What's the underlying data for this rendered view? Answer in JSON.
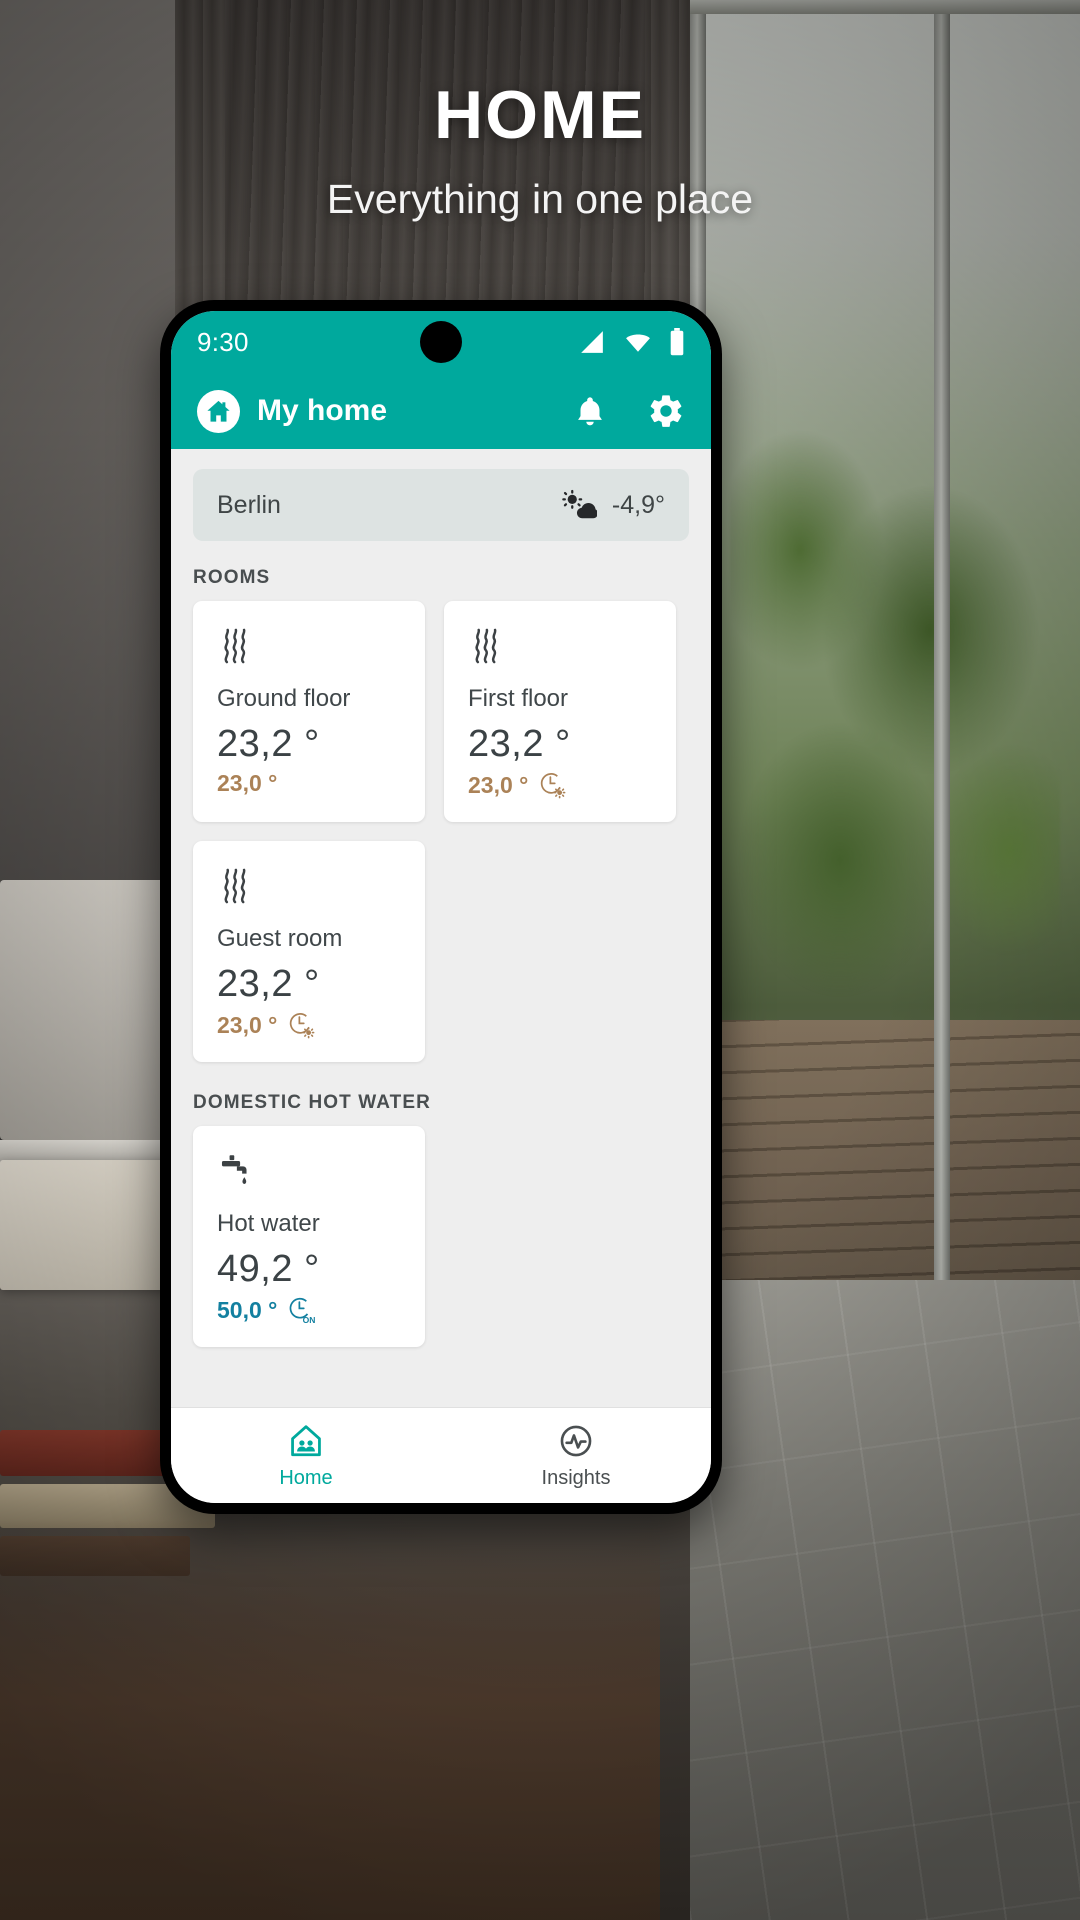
{
  "promo": {
    "title": "HOME",
    "subtitle": "Everything in one place"
  },
  "colors": {
    "brand_teal": "#00a99d",
    "target_warm": "#ab8257",
    "target_cool": "#1380a0",
    "screen_bg": "#eeeeee",
    "card_bg": "#ffffff",
    "weather_bg": "#dde3e2"
  },
  "status_bar": {
    "time": "9:30",
    "icons": [
      "signal-icon",
      "wifi-icon",
      "battery-icon"
    ]
  },
  "app_bar": {
    "home_icon": "home-icon",
    "title": "My home",
    "actions": [
      {
        "name": "notifications-button",
        "icon": "bell-icon"
      },
      {
        "name": "settings-button",
        "icon": "gear-icon"
      }
    ]
  },
  "weather": {
    "city": "Berlin",
    "icon": "sun-cloud-icon",
    "temperature": "-4,9°"
  },
  "sections": [
    {
      "label": "ROOMS"
    },
    {
      "label": "DOMESTIC HOT WATER"
    }
  ],
  "rooms": [
    {
      "icon": "heat-waves-icon",
      "name": "Ground floor",
      "current": "23,2 °",
      "target": "23,0 °",
      "target_color": "warm",
      "badge": null
    },
    {
      "icon": "heat-waves-icon",
      "name": "First floor",
      "current": "23,2 °",
      "target": "23,0 °",
      "target_color": "warm",
      "badge": "clock-sun-icon"
    },
    {
      "icon": "heat-waves-icon",
      "name": "Guest room",
      "current": "23,2 °",
      "target": "23,0 °",
      "target_color": "warm",
      "badge": "clock-sun-icon"
    }
  ],
  "hot_water": [
    {
      "icon": "faucet-icon",
      "name": "Hot water",
      "current": "49,2 °",
      "target": "50,0 °",
      "target_color": "cool",
      "badge": "clock-on-icon"
    }
  ],
  "bottom_nav": [
    {
      "label": "Home",
      "icon": "home-people-icon",
      "active": true
    },
    {
      "label": "Insights",
      "icon": "insights-pulse-icon",
      "active": false
    }
  ]
}
